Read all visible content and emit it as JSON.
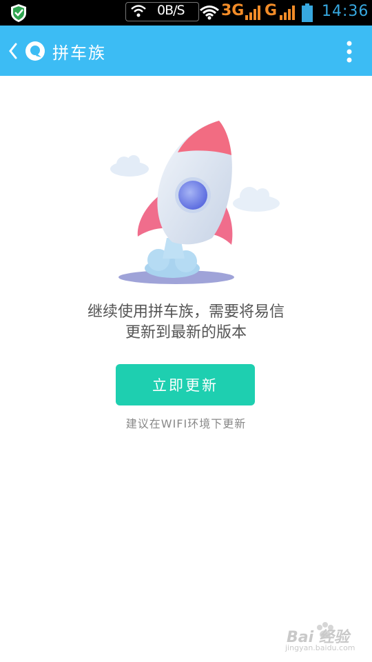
{
  "status_bar": {
    "speed": "0B/S",
    "network_1": "3G",
    "network_2": "G",
    "time": "14:36",
    "accent": "#37a8e0",
    "network_color": "#f28c28"
  },
  "app_bar": {
    "title": "拼车族",
    "background": "#3cbcf4"
  },
  "main": {
    "message_line_1": "继续使用拼车族，需要将易信",
    "message_line_2": "更新到最新的版本",
    "update_button_label": "立即更新",
    "hint": "建议在WIFI环境下更新",
    "button_color": "#1ecfb0"
  },
  "watermark": {
    "text": "Bai 经验",
    "sub": "jingyan.baidu.com"
  }
}
